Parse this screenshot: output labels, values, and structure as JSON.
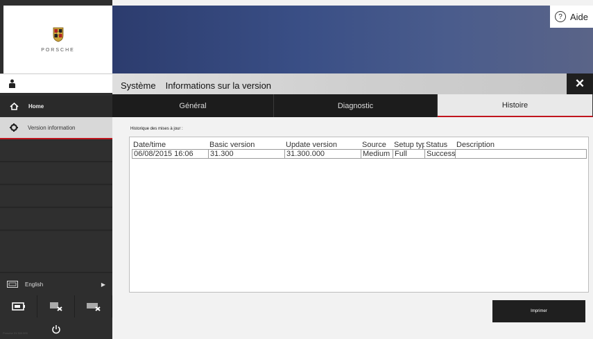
{
  "brand": {
    "logo_text": "PORSCHE"
  },
  "header": {
    "help_label": "Aide",
    "title_system": "Système",
    "title_page": "Informations sur la version",
    "close_glyph": "✕"
  },
  "sidebar": {
    "items": [
      {
        "label": "Home",
        "icon": "home-icon"
      },
      {
        "label": "Version information",
        "icon": "gear-icon"
      }
    ],
    "language": "English",
    "version_text": "Porsche\n31.300.000"
  },
  "tabs": [
    {
      "label": "Général",
      "active": false
    },
    {
      "label": "Diagnostic",
      "active": false
    },
    {
      "label": "Histoire",
      "active": true
    }
  ],
  "history": {
    "label": "Historique des mises à jour :",
    "columns": [
      "Date/time",
      "Basic version",
      "Update version",
      "Source",
      "Setup typ",
      "Status",
      "Description"
    ],
    "rows": [
      [
        "06/08/2015 16:06",
        "31.300",
        "31.300.000",
        "Medium",
        "Full",
        "Success",
        ""
      ]
    ]
  },
  "print_label": "Imprimer",
  "colors": {
    "accent_red": "#c0141d",
    "banner_blue": "#3a4f86",
    "dark": "#1f1f1f"
  }
}
